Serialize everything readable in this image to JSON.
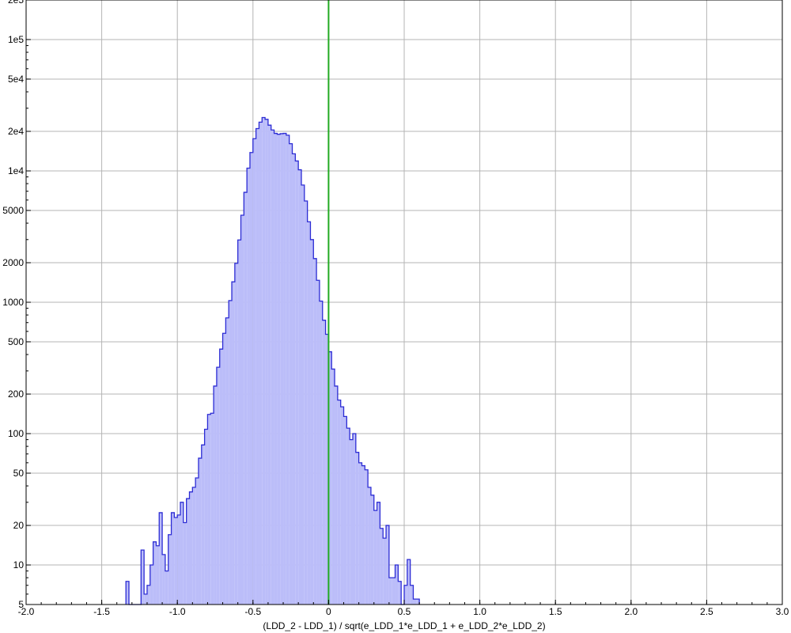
{
  "chart_data": {
    "type": "histogram",
    "title": "",
    "xlabel": "(LDD_2 - LDD_1) / sqrt(e_LDD_1*e_LDD_1 + e_LDD_2*e_LDD_2)",
    "ylabel": "",
    "xlim": [
      -2.0,
      3.0
    ],
    "ylim": [
      5,
      200000
    ],
    "y_scale": "log",
    "grid": true,
    "x_ticks": [
      -2.0,
      -1.5,
      -1.0,
      -0.5,
      0,
      0.5,
      1.0,
      1.5,
      2.0,
      2.5,
      3.0
    ],
    "x_tick_labels": [
      "-2.0",
      "-1.5",
      "-1.0",
      "-0.5",
      "0",
      "0.5",
      "1.0",
      "1.5",
      "2.0",
      "2.5",
      "3.0"
    ],
    "y_ticks": [
      5,
      10,
      20,
      50,
      100,
      200,
      500,
      1000,
      2000,
      5000,
      10000,
      20000,
      50000,
      100000,
      200000
    ],
    "y_tick_labels": [
      "5",
      "10",
      "20",
      "50",
      "100",
      "200",
      "500",
      "1000",
      "2000",
      "5000",
      "1e4",
      "2e4",
      "5e4",
      "1e5",
      "2e5"
    ],
    "bin_start": -1.34,
    "bin_width": 0.02,
    "values": [
      7.5,
      0,
      0,
      0,
      0,
      13,
      6,
      7,
      10,
      15,
      14,
      25,
      12,
      9,
      17,
      25,
      23,
      24,
      30,
      21,
      32,
      36,
      39,
      46,
      65,
      82,
      108,
      140,
      143,
      230,
      320,
      440,
      580,
      760,
      1030,
      1430,
      1980,
      2980,
      4600,
      6870,
      10500,
      13800,
      17600,
      21000,
      23500,
      25500,
      24700,
      22300,
      20500,
      19300,
      19000,
      19200,
      19300,
      18700,
      16100,
      13500,
      11900,
      10200,
      7800,
      5900,
      4100,
      3000,
      2150,
      1470,
      1020,
      730,
      570,
      420,
      310,
      230,
      180,
      160,
      135,
      110,
      90,
      100,
      72,
      60,
      57,
      53,
      39,
      34,
      26,
      30,
      19,
      16,
      20,
      8,
      8,
      10,
      7.5,
      0,
      7,
      11,
      7,
      5.5,
      5.5
    ],
    "series": [
      {
        "name": "",
        "color": "#2c2cd4",
        "fill": "#bbbdf9"
      }
    ],
    "reference_lines": [
      {
        "axis": "x",
        "value": 0,
        "color": "#22aa22"
      }
    ]
  }
}
